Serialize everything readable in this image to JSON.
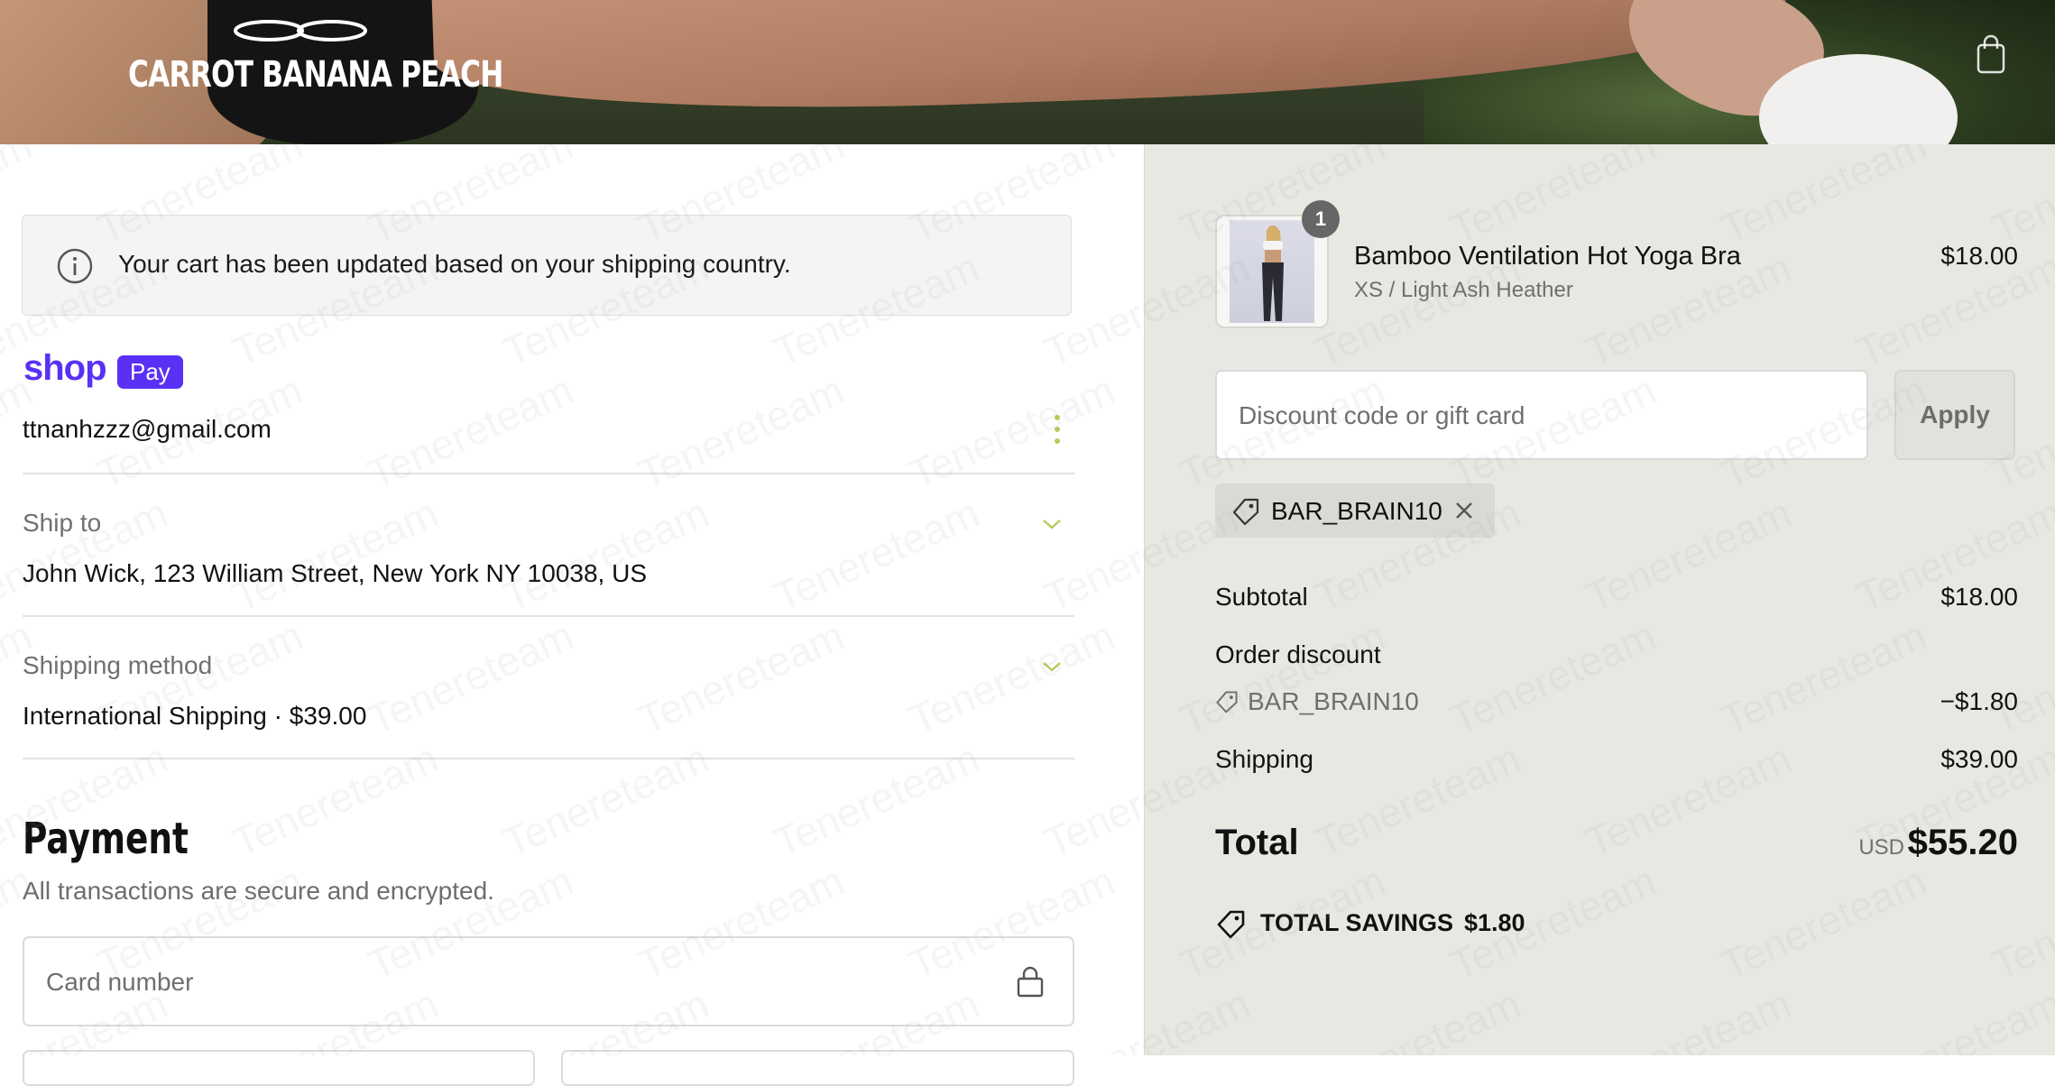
{
  "header": {
    "logo_text": "CARROT BANANA PEACH",
    "cart_icon": "shopping-bag-icon"
  },
  "notice": {
    "icon": "info-icon",
    "text": "Your cart has been updated based on your shipping country."
  },
  "contact": {
    "shop_text": "shop",
    "pay_text": "Pay",
    "email": "ttnanhzzz@gmail.com",
    "menu_icon": "kebab-menu-icon"
  },
  "ship_to": {
    "label": "Ship to",
    "value": "John Wick, 123 William Street, New York NY 10038, US"
  },
  "shipping_method": {
    "label": "Shipping method",
    "name": "International Shipping · ",
    "price": "$39.00"
  },
  "payment": {
    "title": "Payment",
    "subtitle": "All transactions are secure and encrypted.",
    "card_placeholder": "Card number"
  },
  "order": {
    "item": {
      "quantity": "1",
      "name": "Bamboo Ventilation Hot Yoga Bra",
      "variant": "XS / Light Ash Heather",
      "price": "$18.00"
    },
    "discount_placeholder": "Discount code or gift card",
    "apply_label": "Apply",
    "applied_code": "BAR_BRAIN10",
    "subtotal_label": "Subtotal",
    "subtotal_value": "$18.00",
    "discount_label": "Order discount",
    "discount_code": "BAR_BRAIN10",
    "discount_value": "−$1.80",
    "shipping_label": "Shipping",
    "shipping_value": "$39.00",
    "total_label": "Total",
    "total_currency": "USD",
    "total_value": "$55.20",
    "savings_label": "TOTAL SAVINGS",
    "savings_value": "$1.80"
  },
  "watermark": "Tenereteam",
  "colors": {
    "shop_pay_purple": "#5a31f4",
    "summary_bg": "#e8e8e3",
    "accent_chevron": "#b5cc5a"
  }
}
